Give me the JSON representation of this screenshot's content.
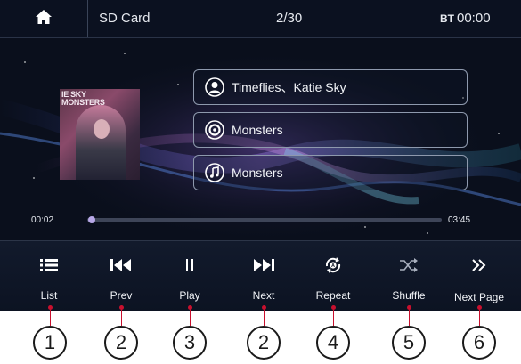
{
  "topbar": {
    "source": "SD Card",
    "track_count": "2/30",
    "clock_prefix": "BT",
    "clock_time": "00:00"
  },
  "track": {
    "artist": "Timeflies、Katie Sky",
    "album": "Monsters",
    "title": "Monsters",
    "album_art_text": "IE SKY\nMONSTERS"
  },
  "progress": {
    "elapsed": "00:02",
    "total": "03:45",
    "fraction": 0.01
  },
  "controls": [
    {
      "label": "List",
      "callout": "1"
    },
    {
      "label": "Prev",
      "callout": "2"
    },
    {
      "label": "Play",
      "callout": "3"
    },
    {
      "label": "Next",
      "callout": "2"
    },
    {
      "label": "Repeat",
      "callout": "4"
    },
    {
      "label": "Shuffle",
      "callout": "5"
    },
    {
      "label": "Next Page",
      "callout": "6"
    }
  ],
  "colors": {
    "callout_line": "#c8102e",
    "screen_bg": "#0a0f1c",
    "accent": "#b8a8e8"
  }
}
